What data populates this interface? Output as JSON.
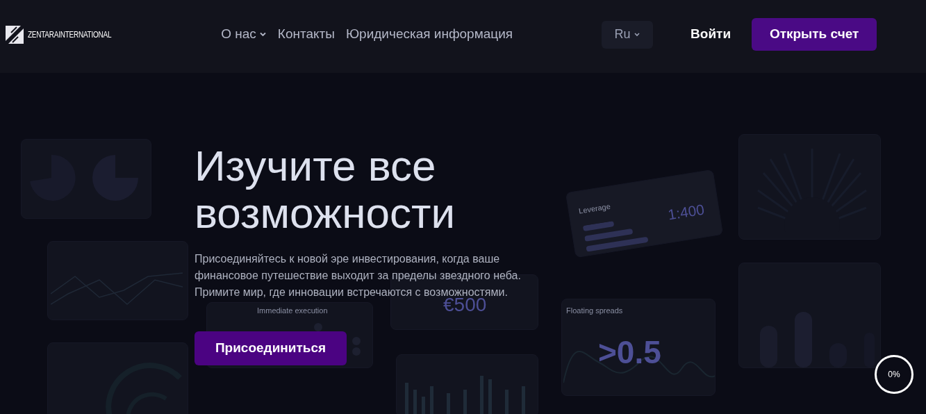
{
  "header": {
    "logo": "ZENTARAINTERNATIONAL",
    "nav": [
      {
        "label": "О нас",
        "has_menu": true
      },
      {
        "label": "Контакты",
        "has_menu": false
      },
      {
        "label": "Юридическая информация",
        "has_menu": false
      }
    ],
    "language": {
      "label": "Ru"
    },
    "login": "Войти",
    "open_account": "Открыть счет"
  },
  "hero": {
    "title_lines": [
      "Изучите все",
      "возможности"
    ],
    "text": "Присоединяйтесь к новой эре инвестирования, когда ваше финансовое путешествие выходит за пределы звездного неба. Примите мир, где инновации встречаются с возможностями.",
    "button": "Присоединиться"
  },
  "cards": [
    {
      "kind": "execution",
      "label": "Immediate execution"
    },
    {
      "kind": "deposit",
      "value": "€500"
    },
    {
      "kind": "leverage",
      "label": "Leverage",
      "value": "1:400"
    },
    {
      "kind": "spreads",
      "label": "Floating spreads",
      "value": ">0.5"
    }
  ],
  "progress": {
    "label": "0%"
  }
}
